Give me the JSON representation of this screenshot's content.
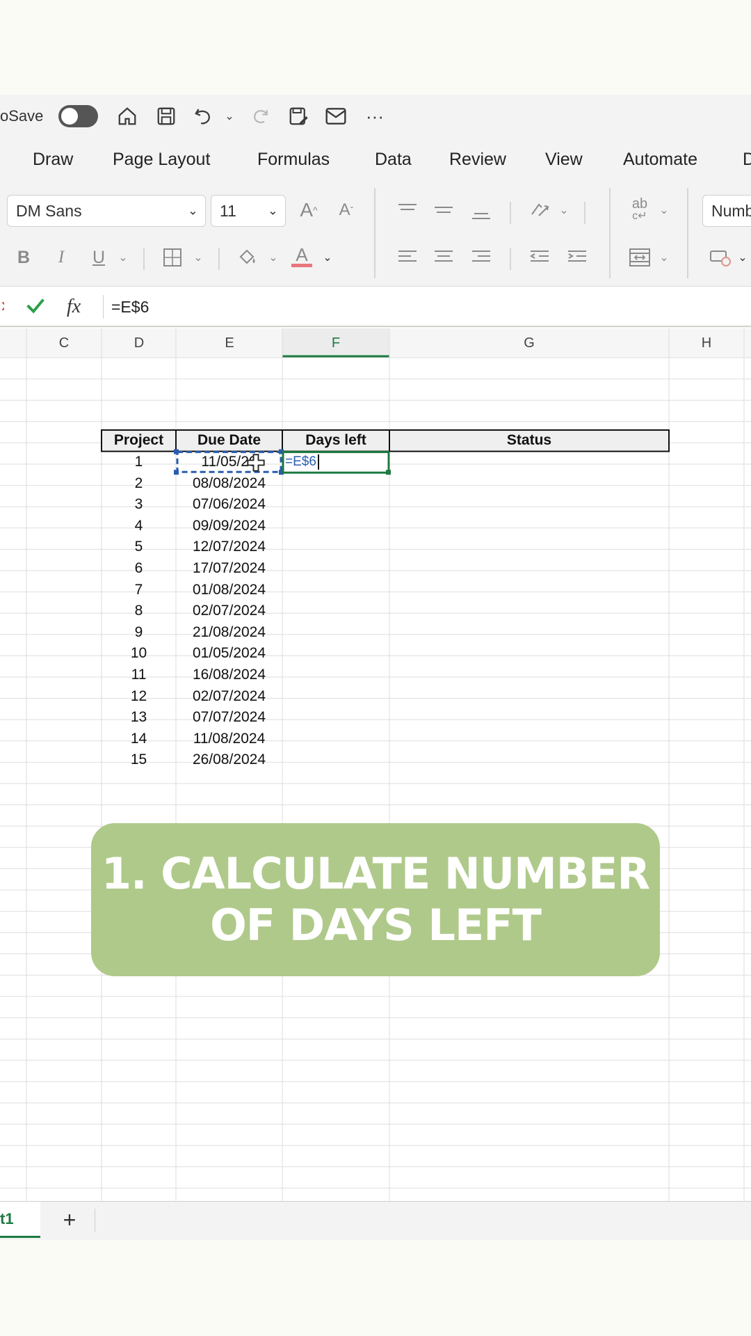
{
  "titlebar": {
    "autosave_label": "oSave",
    "more_label": "···"
  },
  "ribbon_tabs": [
    "Draw",
    "Page Layout",
    "Formulas",
    "Data",
    "Review",
    "View",
    "Automate",
    "D"
  ],
  "ribbon": {
    "font_name": "DM Sans",
    "font_size": "11",
    "number_format": "Numb",
    "bold": "B",
    "italic": "I",
    "underline": "U",
    "grow_font": "A",
    "shrink_font": "A",
    "font_color": "A",
    "font_color_hex": "#e8767c"
  },
  "formula_bar": {
    "fx_label": "fx",
    "formula": "=E$6"
  },
  "columns": [
    "C",
    "D",
    "E",
    "F",
    "G",
    "H"
  ],
  "table": {
    "headers": [
      "Project",
      "Due Date",
      "Days left",
      "Status"
    ],
    "rows": [
      [
        "1",
        "11/05/2024"
      ],
      [
        "2",
        "08/08/2024"
      ],
      [
        "3",
        "07/06/2024"
      ],
      [
        "4",
        "09/09/2024"
      ],
      [
        "5",
        "12/07/2024"
      ],
      [
        "6",
        "17/07/2024"
      ],
      [
        "7",
        "01/08/2024"
      ],
      [
        "8",
        "02/07/2024"
      ],
      [
        "9",
        "21/08/2024"
      ],
      [
        "10",
        "01/05/2024"
      ],
      [
        "11",
        "16/08/2024"
      ],
      [
        "12",
        "02/07/2024"
      ],
      [
        "13",
        "07/07/2024"
      ],
      [
        "14",
        "11/08/2024"
      ],
      [
        "15",
        "26/08/2024"
      ]
    ],
    "editing_cell_value": "=E$6",
    "referenced_cell_display": "11/05/20"
  },
  "sheet_tabs": {
    "active": "t1",
    "add": "+"
  },
  "banner": {
    "line1": "1. CALCULATE NUMBER",
    "line2": "OF DAYS LEFT"
  },
  "colors": {
    "accent_green": "#1d7a42",
    "banner_green": "#afc98a",
    "reference_blue": "#2a5db0"
  }
}
